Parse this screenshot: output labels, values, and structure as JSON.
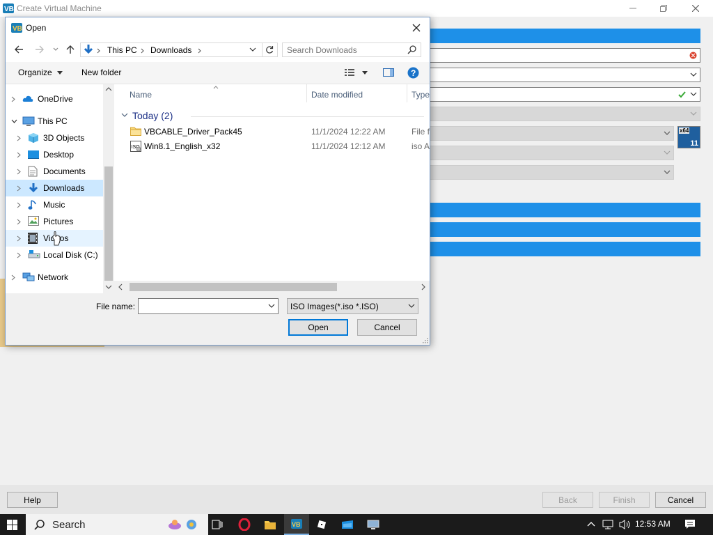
{
  "background_window": {
    "title": "Create Virtual Machine",
    "footer": {
      "help_label": "Help",
      "back_label": "Back",
      "finish_label": "Finish",
      "cancel_label": "Cancel"
    },
    "os_badge": {
      "arch": "x64",
      "version": "11"
    }
  },
  "dialog": {
    "title": "Open",
    "breadcrumb": [
      "This PC",
      "Downloads"
    ],
    "search_placeholder": "Search Downloads",
    "toolbar": {
      "organize_label": "Organize",
      "new_folder_label": "New folder"
    },
    "nav_items": [
      {
        "label": "OneDrive",
        "icon": "cloud-icon"
      },
      {
        "label": "This PC",
        "icon": "computer-icon"
      },
      {
        "label": "3D Objects",
        "icon": "cube-icon"
      },
      {
        "label": "Desktop",
        "icon": "desktop-icon"
      },
      {
        "label": "Documents",
        "icon": "document-icon"
      },
      {
        "label": "Downloads",
        "icon": "download-icon",
        "selected": true
      },
      {
        "label": "Music",
        "icon": "music-icon"
      },
      {
        "label": "Pictures",
        "icon": "pictures-icon"
      },
      {
        "label": "Videos",
        "icon": "video-icon"
      },
      {
        "label": "Local Disk (C:)",
        "icon": "drive-icon"
      },
      {
        "label": "Network",
        "icon": "network-icon"
      }
    ],
    "columns": {
      "name": "Name",
      "date_modified": "Date modified",
      "type": "Type"
    },
    "group_header": "Today (2)",
    "files": [
      {
        "name": "VBCABLE_Driver_Pack45",
        "date": "11/1/2024 12:22 AM",
        "type": "File fo",
        "icon": "folder-icon"
      },
      {
        "name": "Win8.1_English_x32",
        "date": "11/1/2024 12:12 AM",
        "type": "iso A",
        "icon": "iso-file-icon"
      }
    ],
    "file_name_label": "File name:",
    "file_name_value": "",
    "filter_label": "ISO Images(*.iso *.ISO)",
    "open_label": "Open",
    "cancel_label": "Cancel"
  },
  "taskbar": {
    "search_label": "Search",
    "clock": "12:53 AM"
  },
  "colors": {
    "accent_blue": "#1e90e8",
    "selection": "#cce8ff",
    "taskbar": "#1b1b1b"
  }
}
